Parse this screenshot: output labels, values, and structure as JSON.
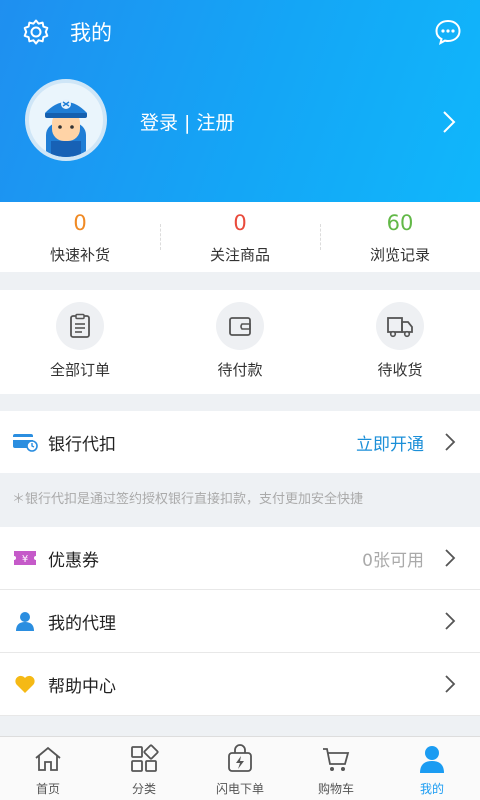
{
  "header": {
    "title": "我的",
    "login_text": "登录 | 注册",
    "bg_color": "#14a6f6"
  },
  "stats": [
    {
      "value": "0",
      "label": "快速补货",
      "color": "#f08a24"
    },
    {
      "value": "0",
      "label": "关注商品",
      "color": "#e94b3c"
    },
    {
      "value": "60",
      "label": "浏览记录",
      "color": "#62b847"
    }
  ],
  "orders": [
    {
      "label": "全部订单",
      "icon": "clipboard-icon"
    },
    {
      "label": "待付款",
      "icon": "wallet-icon"
    },
    {
      "label": "待收货",
      "icon": "truck-icon"
    }
  ],
  "bank": {
    "label": "银行代扣",
    "action": "立即开通",
    "action_color": "#1b8fd8"
  },
  "notice": "＊银行代扣是通过签约授权银行直接扣款，支付更加安全快捷",
  "menu": [
    {
      "label": "优惠券",
      "value": "0张可用",
      "icon": "coupon-icon"
    },
    {
      "label": "我的代理",
      "value": "",
      "icon": "user-icon"
    },
    {
      "label": "帮助中心",
      "value": "",
      "icon": "heart-icon"
    }
  ],
  "tabbar": [
    {
      "label": "首页",
      "icon": "home-icon",
      "active": false
    },
    {
      "label": "分类",
      "icon": "category-icon",
      "active": false
    },
    {
      "label": "闪电下单",
      "icon": "flash-bag-icon",
      "active": false
    },
    {
      "label": "购物车",
      "icon": "cart-icon",
      "active": false
    },
    {
      "label": "我的",
      "icon": "profile-icon",
      "active": true
    }
  ],
  "colors": {
    "accent": "#1b9cf2",
    "inactive": "#555555"
  }
}
